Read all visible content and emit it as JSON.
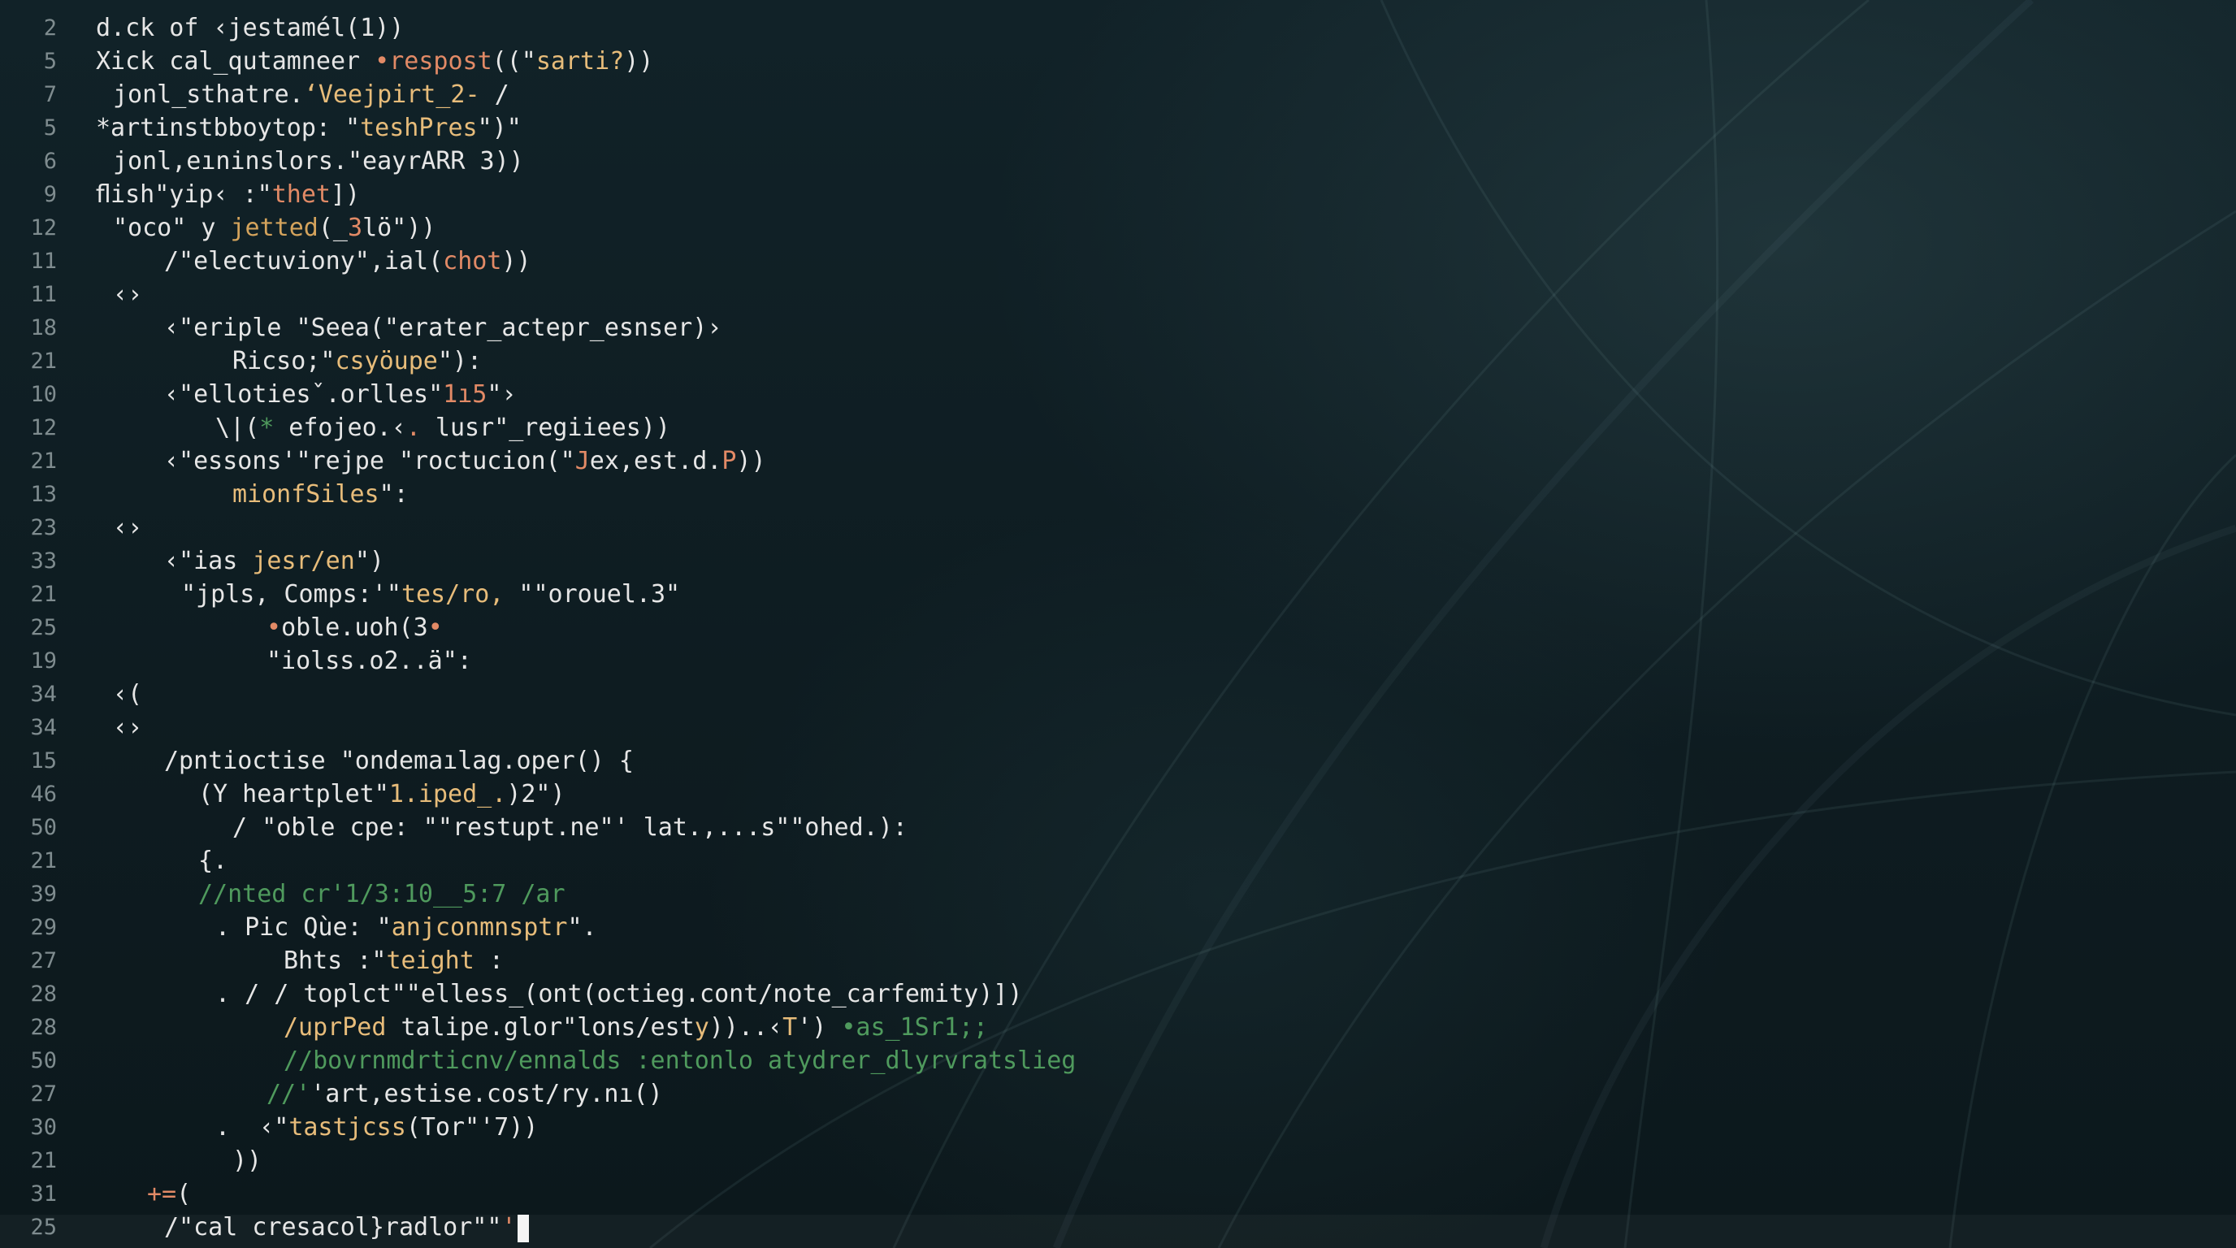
{
  "editor": {
    "lines": [
      {
        "num": "2",
        "indent": 0,
        "segs": [
          [
            "d",
            "d.ck of ‹jestamél(1))"
          ]
        ]
      },
      {
        "num": "5",
        "indent": 0,
        "segs": [
          [
            "d",
            "Xick cal_qutamneer "
          ],
          [
            "r",
            "•respost"
          ],
          [
            "d",
            "((\""
          ],
          [
            "s",
            "sarti?"
          ],
          [
            "d",
            "))"
          ]
        ]
      },
      {
        "num": "7",
        "indent": 1,
        "segs": [
          [
            "d",
            "jonl_sthatre."
          ],
          [
            "s",
            "‘Veejpirt_2-"
          ],
          [
            "d",
            " /"
          ]
        ]
      },
      {
        "num": "5",
        "indent": 0,
        "segs": [
          [
            "d",
            "*artinstbboytop: \""
          ],
          [
            "s",
            "teshPres"
          ],
          [
            "d",
            "\")\""
          ]
        ]
      },
      {
        "num": "6",
        "indent": 1,
        "segs": [
          [
            "d",
            "jonl,eıninslors.\"eayrARR 3))"
          ]
        ]
      },
      {
        "num": "9",
        "indent": 0,
        "segs": [
          [
            "d",
            "ﬂish\"yip‹ :\""
          ],
          [
            "r",
            "thet"
          ],
          [
            "d",
            "])"
          ]
        ]
      },
      {
        "num": "12",
        "indent": 1,
        "segs": [
          [
            "d",
            "\"oco\" y "
          ],
          [
            "k",
            "jetted"
          ],
          [
            "d",
            "(_"
          ],
          [
            "r",
            "3"
          ],
          [
            "d",
            "lö\"))"
          ]
        ]
      },
      {
        "num": "11",
        "indent": 4,
        "segs": [
          [
            "d",
            "/\"electuviony\",ial("
          ],
          [
            "r",
            "chot"
          ],
          [
            "d",
            "))"
          ]
        ]
      },
      {
        "num": "11",
        "indent": 1,
        "segs": [
          [
            "d",
            "‹›"
          ]
        ]
      },
      {
        "num": "18",
        "indent": 4,
        "segs": [
          [
            "d",
            "‹\"eriple \"Seea(\"erater_actepr_esnser)›"
          ]
        ]
      },
      {
        "num": "21",
        "indent": 8,
        "segs": [
          [
            "d",
            "Ricso;\""
          ],
          [
            "s",
            "csyöupe"
          ],
          [
            "d",
            "\"):"
          ]
        ]
      },
      {
        "num": "10",
        "indent": 4,
        "segs": [
          [
            "d",
            "‹\"ellotiesˇ.orlles\""
          ],
          [
            "r",
            "1ı5"
          ],
          [
            "d",
            "\"›"
          ]
        ]
      },
      {
        "num": "12",
        "indent": 7,
        "segs": [
          [
            "d",
            "\\|("
          ],
          [
            "c",
            "*"
          ],
          [
            "d",
            " efojeo.‹"
          ],
          [
            "r",
            "."
          ],
          [
            "d",
            " lusr\"_regiiees))"
          ]
        ]
      },
      {
        "num": "21",
        "indent": 4,
        "segs": [
          [
            "d",
            "‹\"essons'\"rejpe \"roctucion(\""
          ],
          [
            "r",
            "J"
          ],
          [
            "d",
            "ex,est.d."
          ],
          [
            "r",
            "P"
          ],
          [
            "d",
            "))"
          ]
        ]
      },
      {
        "num": "13",
        "indent": 8,
        "segs": [
          [
            "s",
            "mionfSiles"
          ],
          [
            "d",
            "\":"
          ]
        ]
      },
      {
        "num": "23",
        "indent": 1,
        "segs": [
          [
            "d",
            "‹›"
          ]
        ]
      },
      {
        "num": "33",
        "indent": 4,
        "segs": [
          [
            "d",
            "‹\"ias "
          ],
          [
            "s",
            "jesr/en"
          ],
          [
            "d",
            "\")"
          ]
        ]
      },
      {
        "num": "21",
        "indent": 5,
        "segs": [
          [
            "d",
            "\"jpls, Comps:'\""
          ],
          [
            "s",
            "tes/ro,"
          ],
          [
            "d",
            " \"\"orouel.3\""
          ]
        ]
      },
      {
        "num": "25",
        "indent": 10,
        "segs": [
          [
            "r",
            "•"
          ],
          [
            "d",
            "oble.uoh(3"
          ],
          [
            "r",
            "•"
          ]
        ]
      },
      {
        "num": "19",
        "indent": 10,
        "segs": [
          [
            "d",
            "\"iolss.o2..ä\":"
          ]
        ]
      },
      {
        "num": "34",
        "indent": 1,
        "segs": [
          [
            "d",
            "‹("
          ]
        ]
      },
      {
        "num": "34",
        "indent": 1,
        "segs": [
          [
            "d",
            "‹›"
          ]
        ]
      },
      {
        "num": "15",
        "indent": 4,
        "segs": [
          [
            "d",
            "/pntioctise \"ondemaılag.oper() {"
          ]
        ]
      },
      {
        "num": "46",
        "indent": 6,
        "segs": [
          [
            "d",
            "(Y heartplet\""
          ],
          [
            "s",
            "1.iped_."
          ],
          [
            "d",
            ")2\")"
          ]
        ]
      },
      {
        "num": "50",
        "indent": 8,
        "segs": [
          [
            "d",
            "/ \"oble cpe: \"\"restupt.ne\"' lat.,...s\"\"ohed.):"
          ]
        ]
      },
      {
        "num": "21",
        "indent": 6,
        "segs": [
          [
            "d",
            "{."
          ]
        ]
      },
      {
        "num": "39",
        "indent": 6,
        "segs": [
          [
            "c",
            "//nted cr'1/3:10__5:7 /ar"
          ]
        ]
      },
      {
        "num": "29",
        "indent": 7,
        "segs": [
          [
            "d",
            ". Pic Qùe: \""
          ],
          [
            "s",
            "anjconmnsptr"
          ],
          [
            "d",
            "\"."
          ]
        ]
      },
      {
        "num": "27",
        "indent": 11,
        "segs": [
          [
            "d",
            "Bhts :\""
          ],
          [
            "s",
            "teight"
          ],
          [
            "d",
            " :"
          ]
        ]
      },
      {
        "num": "28",
        "indent": 7,
        "segs": [
          [
            "d",
            ". / / toplct\"\"elless_(ont(octieg.cont/note_carfemity)])"
          ]
        ]
      },
      {
        "num": "28",
        "indent": 11,
        "segs": [
          [
            "s",
            "/uprPed "
          ],
          [
            "d",
            "talipe.glor\"lons/est"
          ],
          [
            "s",
            "y"
          ],
          [
            "d",
            "))..‹"
          ],
          [
            "s",
            "T"
          ],
          [
            "d",
            "') "
          ],
          [
            "c",
            "•as_1Sr1;;"
          ]
        ]
      },
      {
        "num": "50",
        "indent": 11,
        "segs": [
          [
            "c",
            "//bovrnmdrticnv/ennalds :entonlo atydrer_dlyrvratslieg"
          ]
        ]
      },
      {
        "num": "27",
        "indent": 10,
        "segs": [
          [
            "c",
            "//'"
          ],
          [
            "d",
            "'art,estise.cost/ry.nı()"
          ]
        ]
      },
      {
        "num": "30",
        "indent": 7,
        "segs": [
          [
            "d",
            ".  ‹\""
          ],
          [
            "s",
            "tastjcss"
          ],
          [
            "d",
            "(Tor\"'7))"
          ]
        ]
      },
      {
        "num": "21",
        "indent": 8,
        "segs": [
          [
            "d",
            "))"
          ]
        ]
      },
      {
        "num": "31",
        "indent": 3,
        "segs": [
          [
            "r",
            "+="
          ],
          [
            "d",
            "("
          ]
        ]
      },
      {
        "num": "25",
        "indent": 4,
        "segs": [
          [
            "d",
            "/\"cal cresacol}radlor\"\""
          ],
          [
            "r",
            "'"
          ]
        ]
      }
    ]
  }
}
